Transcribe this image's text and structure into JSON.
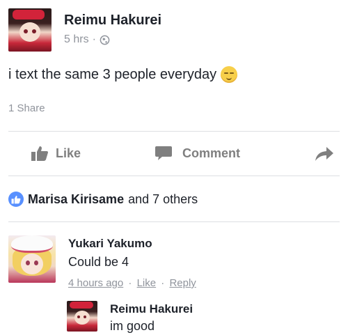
{
  "post": {
    "author": "Reimu Hakurei",
    "time": "5 hrs",
    "separator": "·",
    "privacy_icon": "globe-icon",
    "text": "i text the same 3 people everyday",
    "emoji": "relieved-face",
    "shares": "1 Share"
  },
  "actions": {
    "like": "Like",
    "comment": "Comment",
    "share_icon": "share-arrow-icon"
  },
  "reactions": {
    "names": "Marisa Kirisame",
    "others": "and 7 others"
  },
  "comments": [
    {
      "author": "Yukari Yakumo",
      "text": "Could be 4",
      "time": "4 hours ago",
      "sep1": "·",
      "like": "Like",
      "sep2": "·",
      "reply": "Reply"
    }
  ],
  "reply": {
    "author": "Reimu Hakurei",
    "text": "im good"
  },
  "colors": {
    "like_blue": "#5890ff",
    "meta_gray": "#90949c",
    "action_gray": "#7f7f7f"
  }
}
